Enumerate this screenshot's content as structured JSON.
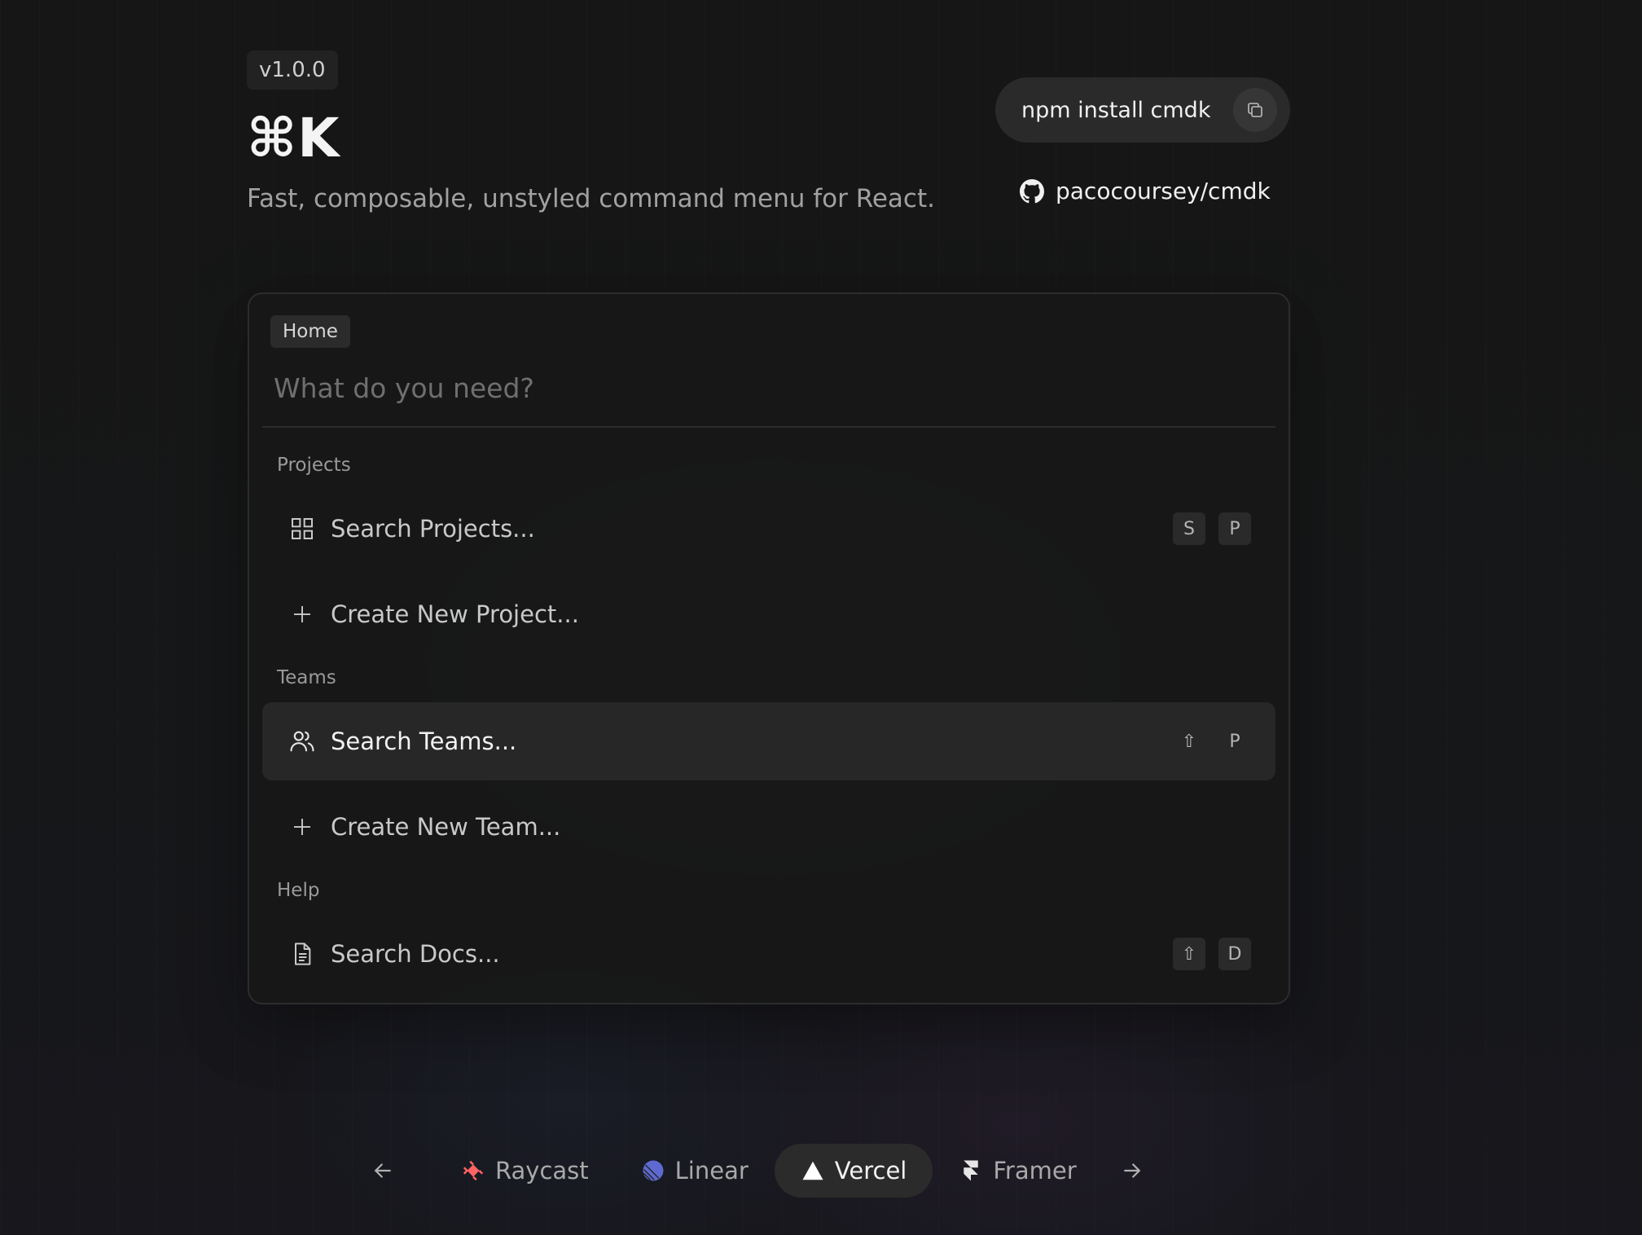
{
  "header": {
    "version": "v1.0.0",
    "logo": "⌘K",
    "tagline": "Fast, composable, unstyled command menu for React.",
    "install_command": "npm install cmdk",
    "repo": "pacocoursey/cmdk"
  },
  "command_menu": {
    "page_badge": "Home",
    "search_placeholder": "What do you need?",
    "groups": [
      {
        "heading": "Projects",
        "items": [
          {
            "label": "Search Projects...",
            "icon": "grid-icon",
            "shortcut": [
              "S",
              "P"
            ]
          },
          {
            "label": "Create New Project...",
            "icon": "plus-icon",
            "shortcut": []
          }
        ]
      },
      {
        "heading": "Teams",
        "items": [
          {
            "label": "Search Teams...",
            "icon": "users-icon",
            "shortcut": [
              "⇧",
              "P"
            ],
            "selected": true
          },
          {
            "label": "Create New Team...",
            "icon": "plus-icon",
            "shortcut": []
          }
        ]
      },
      {
        "heading": "Help",
        "items": [
          {
            "label": "Search Docs...",
            "icon": "document-icon",
            "shortcut": [
              "⇧",
              "D"
            ]
          }
        ]
      }
    ]
  },
  "themes": {
    "items": [
      {
        "label": "Raycast",
        "icon": "raycast-icon"
      },
      {
        "label": "Linear",
        "icon": "linear-icon"
      },
      {
        "label": "Vercel",
        "icon": "vercel-icon",
        "active": true
      },
      {
        "label": "Framer",
        "icon": "framer-icon"
      }
    ]
  },
  "colors": {
    "background": "#171717",
    "panel": "#181818",
    "selected_row": "#272727",
    "raycast": "#ff6363",
    "linear": "#5e6ad2"
  }
}
